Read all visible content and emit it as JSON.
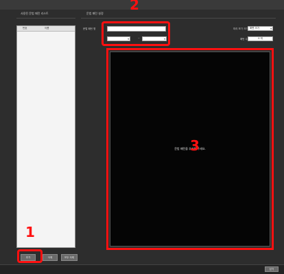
{
  "left_section": {
    "title": "사용된 문법 패턴 리스트",
    "columns": [
      "번호",
      "이름"
    ],
    "buttons": {
      "add": "추가",
      "delete": "삭제",
      "delete_all": "모두 삭제"
    }
  },
  "right_section": {
    "title": "문법 패턴 설정",
    "pattern_name_label": "문법 패턴 명",
    "pattern_name_value": "",
    "start_select": "",
    "range_separator": "~",
    "end_select": "",
    "preview_screen_label": "미리 보기 크기",
    "preview_screen_value": "화면 크기",
    "count_label": "패턴 수",
    "count_value": "0 개",
    "preview_message": "문법 패턴을 추가해 주세요."
  },
  "bottom_bar": {
    "close_label": "닫기"
  },
  "annotations": {
    "marker_1": "1",
    "marker_2": "2",
    "marker_3": "3",
    "highlight_color": "#ff1010"
  },
  "colors": {
    "background": "#2d2d2d",
    "preview": "#050505",
    "list_panel": "#f4f4f4"
  }
}
